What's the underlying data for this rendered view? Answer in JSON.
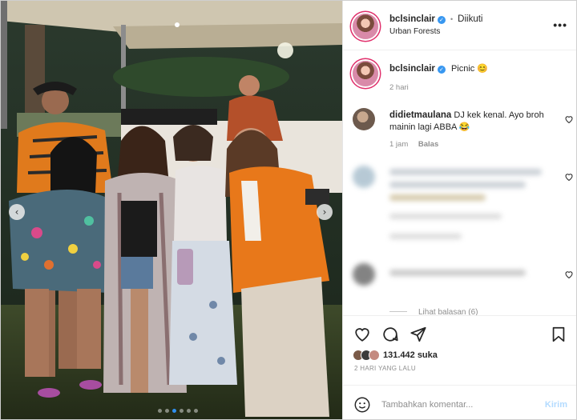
{
  "photo": {
    "prev_arrow": "‹",
    "next_arrow": "›",
    "dot_count": 6,
    "active_dot": 3
  },
  "header": {
    "username": "bclsinclair",
    "separator": "•",
    "follow_status": "Diikuti",
    "location": "Urban Forests",
    "more": "•••"
  },
  "caption": {
    "username": "bclsinclair",
    "text": "Picnic",
    "emoji": "😊",
    "time": "2 hari"
  },
  "comments": [
    {
      "username": "didietmaulana",
      "text": "DJ kek kenal. Ayo broh mainin lagi ABBA",
      "emoji": "😂",
      "time": "1 jam",
      "reply": "Balas"
    }
  ],
  "replies_toggle": "Lihat balasan (6)",
  "likes": {
    "count": "131.442 suka"
  },
  "post_date": "2 HARI YANG LALU",
  "composer": {
    "placeholder": "Tambahkan komentar...",
    "send": "Kirim"
  },
  "colors": {
    "verified": "#3897f0",
    "link_disabled": "#b3dbff",
    "story_ring": "#e1306c"
  }
}
